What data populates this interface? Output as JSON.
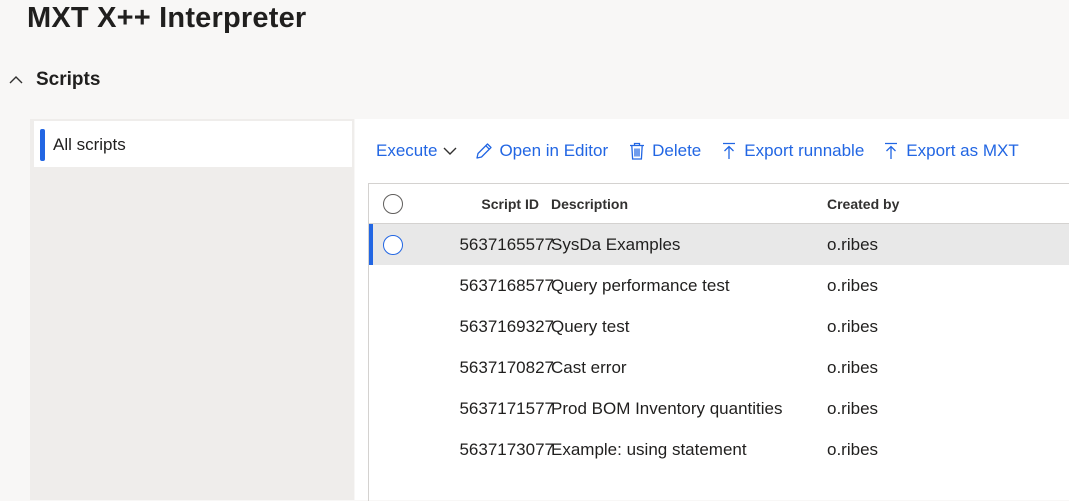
{
  "app": {
    "title": "MXT X++ Interpreter"
  },
  "section": {
    "label": "Scripts",
    "icon": "chevron-up-icon"
  },
  "sidebar": {
    "items": [
      {
        "label": "All scripts",
        "selected": true
      }
    ]
  },
  "toolbar": {
    "execute_label": "Execute",
    "open_label": "Open in Editor",
    "delete_label": "Delete",
    "export_runnable_label": "Export runnable",
    "export_mxt_label": "Export as MXT"
  },
  "grid": {
    "columns": {
      "id": "Script ID",
      "description": "Description",
      "created_by": "Created by"
    },
    "rows": [
      {
        "id": "5637165577",
        "description": "SysDa Examples",
        "created_by": "o.ribes",
        "selected": true
      },
      {
        "id": "5637168577",
        "description": "Query performance test",
        "created_by": "o.ribes"
      },
      {
        "id": "5637169327",
        "description": "Query test",
        "created_by": "o.ribes"
      },
      {
        "id": "5637170827",
        "description": "Cast error",
        "created_by": "o.ribes"
      },
      {
        "id": "5637171577",
        "description": "Prod BOM Inventory quantities",
        "created_by": "o.ribes"
      },
      {
        "id": "5637173077",
        "description": "Example: using statement",
        "created_by": "o.ribes"
      }
    ]
  },
  "colors": {
    "accent": "#2266e3",
    "selected_row": "#e8e8e8",
    "sidebar_bg": "#efedeb",
    "page_bg": "#f8f7f6"
  }
}
